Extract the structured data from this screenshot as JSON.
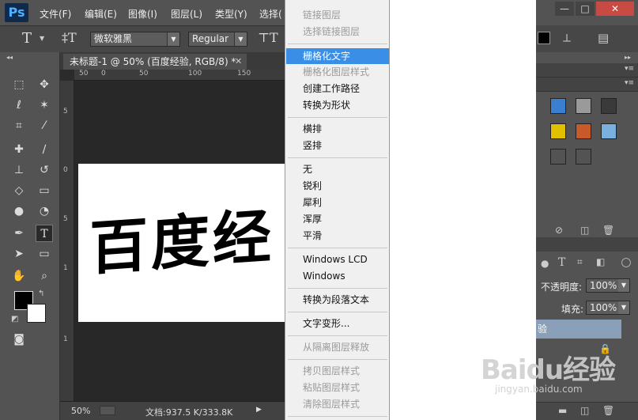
{
  "app": {
    "logo": "Ps"
  },
  "menubar": {
    "items": [
      "文件(F)",
      "编辑(E)",
      "图像(I)",
      "图层(L)",
      "类型(Y)",
      "选择("
    ]
  },
  "options": {
    "font_family": "微软雅黑",
    "font_style": "Regular"
  },
  "document": {
    "tab_title": "未标题-1 @ 50% (百度经验, RGB/8) *",
    "canvas_text": "百度经",
    "ruler_top": [
      "50",
      "0",
      "50",
      "100",
      "150"
    ],
    "ruler_left": [
      "5",
      "0",
      "5",
      "1",
      "1"
    ]
  },
  "status": {
    "zoom": "50%",
    "doc_info": "文档:937.5 K/333.8K"
  },
  "context_menu": {
    "items": [
      {
        "label": "链接图层",
        "state": "disabled"
      },
      {
        "label": "选择链接图层",
        "state": "disabled"
      },
      {
        "label": "栅格化文字",
        "state": "highlight"
      },
      {
        "label": "栅格化图层样式",
        "state": "disabled"
      },
      {
        "label": "创建工作路径",
        "state": "normal"
      },
      {
        "label": "转换为形状",
        "state": "normal"
      },
      {
        "label": "横排",
        "state": "normal"
      },
      {
        "label": "竖排",
        "state": "normal"
      },
      {
        "label": "无",
        "state": "normal"
      },
      {
        "label": "锐利",
        "state": "normal"
      },
      {
        "label": "犀利",
        "state": "normal"
      },
      {
        "label": "浑厚",
        "state": "normal"
      },
      {
        "label": "平滑",
        "state": "normal"
      },
      {
        "label": "Windows LCD",
        "state": "normal"
      },
      {
        "label": "Windows",
        "state": "normal"
      },
      {
        "label": "转换为段落文本",
        "state": "normal"
      },
      {
        "label": "文字变形...",
        "state": "normal"
      },
      {
        "label": "从隔离图层释放",
        "state": "disabled"
      },
      {
        "label": "拷贝图层样式",
        "state": "disabled"
      },
      {
        "label": "粘贴图层样式",
        "state": "disabled"
      },
      {
        "label": "清除图层样式",
        "state": "disabled"
      }
    ]
  },
  "layers_panel": {
    "opacity_label": "不透明度:",
    "opacity_value": "100%",
    "fill_label": "填充:",
    "fill_value": "100%",
    "layer_name": "验"
  },
  "window": {
    "minimize": "—",
    "maximize": "□",
    "close": "✕"
  },
  "watermark": {
    "logo": "Baidu经验",
    "url": "jingyan.baidu.com"
  },
  "colors": {
    "accent": "#3a8ee6",
    "panel": "#535353",
    "workspace": "#282828"
  }
}
